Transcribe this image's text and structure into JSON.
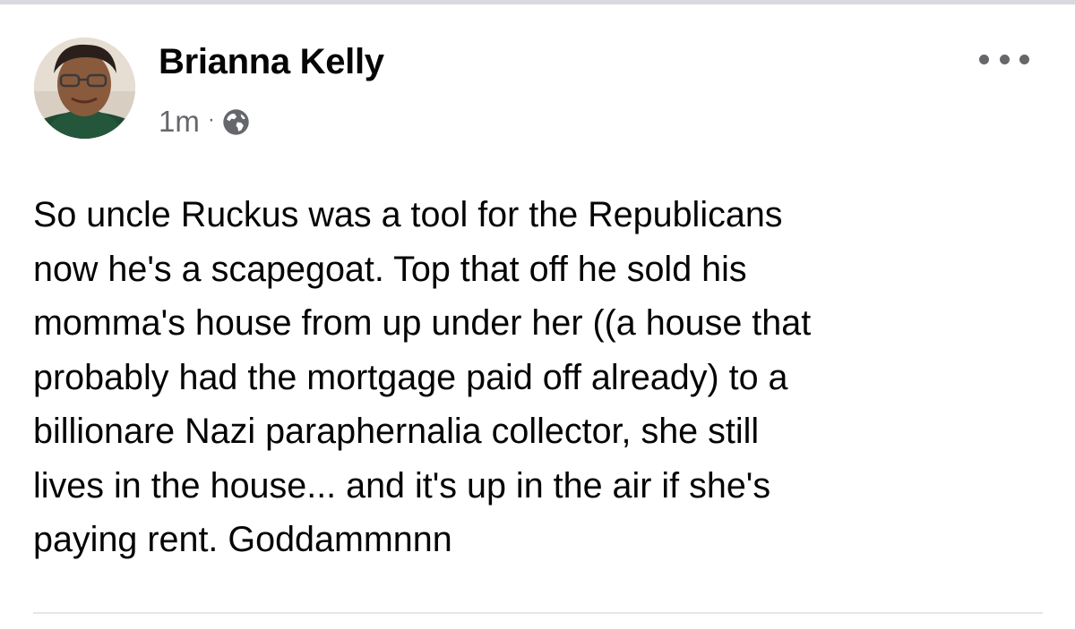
{
  "post": {
    "author": "Brianna Kelly",
    "timestamp": "1m",
    "separator": "·",
    "privacy_icon": "globe-icon",
    "more_icon": "more-horizontal-icon",
    "text_lines": [
      "So uncle Ruckus was a tool for the Republicans",
      "now he's a scapegoat. Top that off he sold his",
      "momma's house from up under her ((a house that",
      "probably had the mortgage paid off already) to a",
      "billionare Nazi paraphernalia collector, she still",
      "lives in the house... and it's up in the air if she's",
      "paying rent. Goddammnnn"
    ]
  },
  "colors": {
    "text_primary": "#050505",
    "text_secondary": "#65676b",
    "divider": "#e4e6eb",
    "top_rule": "#d9dadf"
  }
}
